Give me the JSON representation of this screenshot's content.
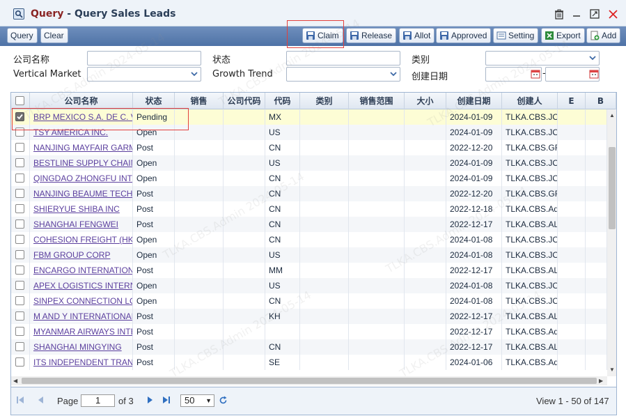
{
  "window": {
    "title_prefix": "Query",
    "title_sep": " - ",
    "title_main": "Query Sales Leads"
  },
  "toolbar": {
    "query_label": "Query",
    "clear_label": "Clear",
    "claim_label": "Claim",
    "release_label": "Release",
    "allot_label": "Allot",
    "approved_label": "Approved",
    "setting_label": "Setting",
    "export_label": "Export",
    "add_label": "Add"
  },
  "filters": {
    "company_name_label": "公司名称",
    "status_label": "状态",
    "category_label": "类别",
    "vertical_market_label": "Vertical Market",
    "growth_trend_label": "Growth Trend",
    "created_date_label": "创建日期",
    "date_sep": "-"
  },
  "grid": {
    "columns": [
      "公司名称",
      "状态",
      "销售",
      "公司代码",
      "代码",
      "类别",
      "销售范围",
      "大小",
      "创建日期",
      "创建人",
      "E",
      "B"
    ],
    "rows": [
      {
        "company": "BRP MEXICO S.A. DE C. V.",
        "status": "Pending",
        "code": "MX",
        "date": "2024-01-09",
        "creator": "TLKA.CBS.JO",
        "checked": true
      },
      {
        "company": "TSY AMERICA INC.",
        "status": "Open",
        "code": "US",
        "date": "2024-01-09",
        "creator": "TLKA.CBS.JO",
        "checked": false
      },
      {
        "company": "NANJING MAYFAIR GARMENT",
        "status": "Post",
        "code": "CN",
        "date": "2022-12-20",
        "creator": "TLKA.CBS.GR",
        "checked": false
      },
      {
        "company": "BESTLINE SUPPLY CHAIN",
        "status": "Open",
        "code": "US",
        "date": "2024-01-09",
        "creator": "TLKA.CBS.JO",
        "checked": false
      },
      {
        "company": "QINGDAO ZHONGFU INTL",
        "status": "Open",
        "code": "CN",
        "date": "2024-01-09",
        "creator": "TLKA.CBS.JO",
        "checked": false
      },
      {
        "company": "NANJING BEAUME TECH",
        "status": "Post",
        "code": "CN",
        "date": "2022-12-20",
        "creator": "TLKA.CBS.GR",
        "checked": false
      },
      {
        "company": "SHIERYUE SHIBA INC",
        "status": "Post",
        "code": "CN",
        "date": "2022-12-18",
        "creator": "TLKA.CBS.Ad",
        "checked": false
      },
      {
        "company": "SHANGHAI FENGWEI",
        "status": "Post",
        "code": "CN",
        "date": "2022-12-17",
        "creator": "TLKA.CBS.AL",
        "checked": false
      },
      {
        "company": "COHESION FREIGHT (HK)",
        "status": "Open",
        "code": "CN",
        "date": "2024-01-08",
        "creator": "TLKA.CBS.JO",
        "checked": false
      },
      {
        "company": "FBM GROUP CORP",
        "status": "Open",
        "code": "US",
        "date": "2024-01-08",
        "creator": "TLKA.CBS.JO",
        "checked": false
      },
      {
        "company": "ENCARGO INTERNATIONAL",
        "status": "Post",
        "code": "MM",
        "date": "2022-12-17",
        "creator": "TLKA.CBS.AL",
        "checked": false
      },
      {
        "company": "APEX LOGISTICS INTERNATIONAL",
        "status": "Open",
        "code": "US",
        "date": "2024-01-08",
        "creator": "TLKA.CBS.JO",
        "checked": false
      },
      {
        "company": "SINPEX CONNECTION LOGISTICS",
        "status": "Open",
        "code": "CN",
        "date": "2024-01-08",
        "creator": "TLKA.CBS.JO",
        "checked": false
      },
      {
        "company": "M AND Y INTERNATIONAL",
        "status": "Post",
        "code": "KH",
        "date": "2022-12-17",
        "creator": "TLKA.CBS.AL",
        "checked": false
      },
      {
        "company": "MYANMAR AIRWAYS INTERNATIONAL",
        "status": "Post",
        "code": "",
        "date": "2022-12-17",
        "creator": "TLKA.CBS.Ad",
        "checked": false
      },
      {
        "company": "SHANGHAI MINGYING",
        "status": "Post",
        "code": "CN",
        "date": "2022-12-17",
        "creator": "TLKA.CBS.AL",
        "checked": false
      },
      {
        "company": "ITS INDEPENDENT TRANSPORT",
        "status": "Post",
        "code": "SE",
        "date": "2024-01-06",
        "creator": "TLKA.CBS.Ad",
        "checked": false
      }
    ]
  },
  "pager": {
    "page_label": "Page",
    "current_page": "1",
    "of_label": "of 3",
    "page_size": "50",
    "summary": "View 1 - 50 of 147"
  },
  "watermark": "TLKA.CBS.Admin 2024-05-14"
}
